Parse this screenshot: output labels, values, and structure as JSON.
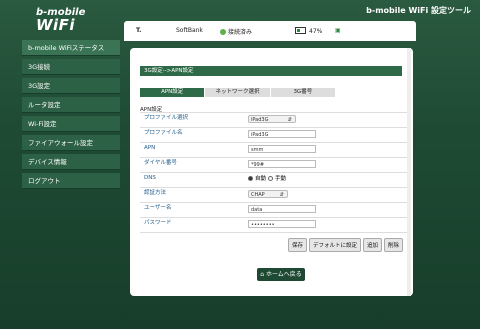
{
  "header": {
    "logo_line1": "b-mobile",
    "logo_line2": "WiFi",
    "app_title": "b-mobile WiFi 設定ツール"
  },
  "status": {
    "signal_label": "T.",
    "carrier": "SoftBank",
    "connection": "接続済み",
    "battery": "47%"
  },
  "sidebar": {
    "items": [
      {
        "label": "b-mobile WiFiステータス"
      },
      {
        "label": "3G接続"
      },
      {
        "label": "3G設定"
      },
      {
        "label": "ルータ設定"
      },
      {
        "label": "Wi-Fi設定"
      },
      {
        "label": "ファイアウォール設定"
      },
      {
        "label": "デバイス情報"
      },
      {
        "label": "ログアウト"
      }
    ]
  },
  "main": {
    "breadcrumb": "3G設定-->APN設定",
    "tabs": [
      {
        "label": "APN設定"
      },
      {
        "label": "ネットワーク選択"
      },
      {
        "label": "3G番号"
      }
    ],
    "section_title": "APN設定",
    "fields": {
      "profile_select": {
        "label": "プロファイル選択",
        "value": "iPad3G"
      },
      "profile_name": {
        "label": "プロファイル名",
        "value": "iPad3G"
      },
      "apn": {
        "label": "APN",
        "value": "smm"
      },
      "dial": {
        "label": "ダイヤル番号",
        "value": "*99#"
      },
      "dns": {
        "label": "DNS",
        "options": [
          "自動",
          "手動"
        ]
      },
      "auth": {
        "label": "認証方法",
        "value": "CHAP"
      },
      "username": {
        "label": "ユーザー名",
        "value": "data"
      },
      "password": {
        "label": "パスワード",
        "value": "••••••••"
      }
    },
    "buttons": {
      "save": "保存",
      "default": "デフォルトに設定",
      "add": "追加",
      "delete": "削除"
    },
    "home_button": "ホームへ戻る"
  }
}
